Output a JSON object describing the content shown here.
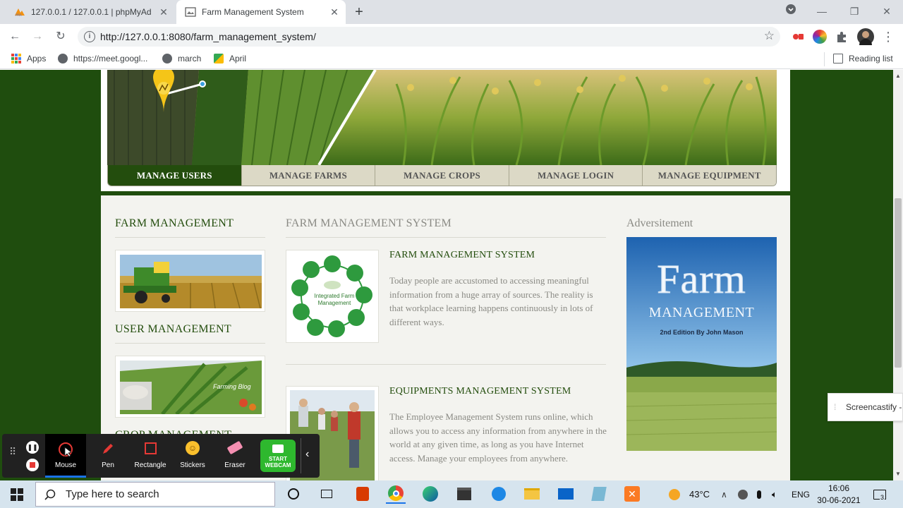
{
  "browser": {
    "tabs": [
      {
        "label": "127.0.0.1 / 127.0.0.1 | phpMyAdmin",
        "active": false
      },
      {
        "label": "Farm Management System",
        "active": true
      }
    ],
    "new_tab": "+",
    "url": "http://127.0.0.1:8080/farm_management_system/",
    "bookmarks": [
      {
        "label": "Apps"
      },
      {
        "label": "https://meet.googl..."
      },
      {
        "label": "march"
      },
      {
        "label": "April"
      }
    ],
    "reading_list": "Reading list"
  },
  "site": {
    "nav": [
      {
        "label": "MANAGE USERS",
        "active": true
      },
      {
        "label": "MANAGE FARMS",
        "active": false
      },
      {
        "label": "MANAGE CROPS",
        "active": false
      },
      {
        "label": "MANAGE LOGIN",
        "active": false
      },
      {
        "label": "MANAGE EQUIPMENT",
        "active": false
      }
    ],
    "left": {
      "heading1": "FARM MANAGEMENT",
      "heading2": "USER MANAGEMENT",
      "heading3": "CROP MANAGEMENT",
      "farming_blog_caption": "Farming Blog"
    },
    "middle": {
      "heading": "FARM MANAGEMENT SYSTEM",
      "articles": [
        {
          "title": "FARM MANAGEMENT SYSTEM",
          "text": "Today people are accustomed to accessing meaningful information from a huge array of sources. The reality is that workplace learning happens continuously in lots of different ways.",
          "image_caption": "Integrated Farm Management"
        },
        {
          "title": "EQUIPMENTS MANAGEMENT SYSTEM",
          "text": "The Employee Management System runs online, which allows you to access any information from anywhere in the world at any given time, as long as you have Internet access. Manage your employees from anywhere."
        }
      ]
    },
    "right": {
      "heading": "Adversitement",
      "ad_title": "Farm",
      "ad_subtitle": "MANAGEMENT",
      "ad_edition": "2nd Edition By John Mason"
    }
  },
  "screencastify": {
    "tools": [
      {
        "label": "Mouse",
        "active": true
      },
      {
        "label": "Pen"
      },
      {
        "label": "Rectangle"
      },
      {
        "label": "Stickers"
      },
      {
        "label": "Eraser"
      }
    ],
    "webcam_label": "START WEBCAM",
    "side_tab": "Screencastify - :"
  },
  "taskbar": {
    "search_placeholder": "Type here to search",
    "weather": "43°C",
    "language": "ENG",
    "time": "16:06",
    "date": "30-06-2021",
    "notifications": "3"
  },
  "colors": {
    "site_green": "#1f4d0e",
    "nav_active": "#234d0d",
    "nav_inactive": "#dcd9c6",
    "heading_green": "#234d0d",
    "muted_text": "#8a8a84"
  }
}
